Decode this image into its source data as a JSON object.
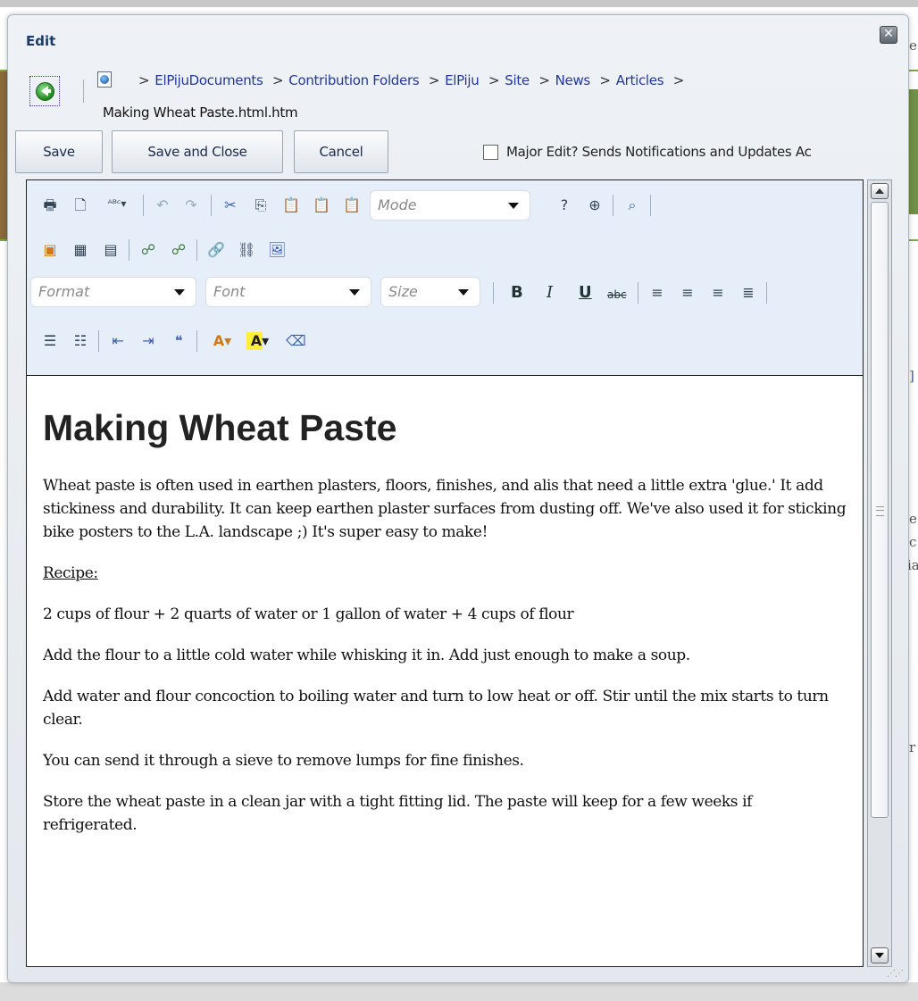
{
  "dialog": {
    "title": "Edit",
    "close_symbol": "✕"
  },
  "background": {
    "frag1": "e",
    "frag2": "e",
    "frag3": "c",
    "frag4": "ia",
    "frag5": "r",
    "frag6": "]"
  },
  "breadcrumb": {
    "items": [
      "ElPijuDocuments",
      "Contribution Folders",
      "ElPiju",
      "Site",
      "News",
      "Articles"
    ],
    "separator": ">",
    "current_file": "Making Wheat Paste.html.htm"
  },
  "actions": {
    "save": "Save",
    "save_and_close": "Save and Close",
    "cancel": "Cancel",
    "major_edit_label": "Major Edit? Sends Notifications and Updates Ac"
  },
  "toolbar": {
    "mode_placeholder": "Mode",
    "format_placeholder": "Format",
    "font_placeholder": "Font",
    "size_placeholder": "Size",
    "bold": "B",
    "italic": "I",
    "underline": "U",
    "strike": "abc"
  },
  "article": {
    "heading": "Making Wheat Paste",
    "intro": "Wheat paste is often used in earthen plasters, floors, finishes, and alis that need a little extra 'glue.' It add stickiness and durability. It can keep earthen plaster surfaces from dusting off. We've also used it for sticking bike posters to the L.A. landscape ;) It's super easy to make!",
    "recipe_label": "Recipe:",
    "paragraphs": [
      "2 cups of flour + 2 quarts of water or 1 gallon of water + 4 cups of flour",
      "Add the flour to a little cold water while whisking it in. Add just enough to make a soup.",
      "Add water and flour concoction to boiling water and turn to low heat or off. Stir until the mix starts to turn clear.",
      "You can send it through a sieve to remove lumps for fine finishes.",
      "Store the wheat paste in a clean jar with a tight fitting lid. The paste will keep for a few weeks if refrigerated."
    ]
  }
}
